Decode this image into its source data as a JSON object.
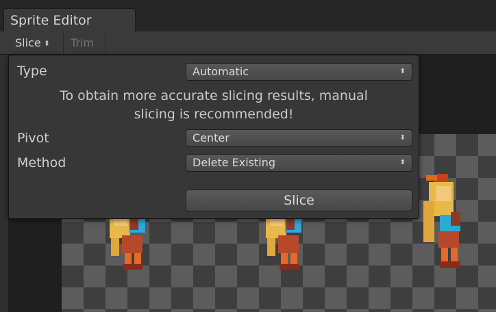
{
  "window": {
    "tab_title": "Sprite Editor"
  },
  "toolbar": {
    "slice_label": "Slice",
    "trim_label": "Trim",
    "stepper_glyph": "⬍"
  },
  "popup": {
    "type_label": "Type",
    "type_value": "Automatic",
    "warning_line1": "To obtain more accurate slicing results, manual",
    "warning_line2": "slicing is recommended!",
    "pivot_label": "Pivot",
    "pivot_value": "Center",
    "method_label": "Method",
    "method_value": "Delete Existing",
    "slice_button": "Slice",
    "dropdown_arrow_glyph": "⬍"
  },
  "icons": [
    "dropdown-stepper-icon"
  ],
  "colors": {
    "panel_bg": "#373737",
    "toolbar_bg": "#3a3a3a",
    "checker_dark": "#3e3e3e",
    "checker_light": "#5c5c5c"
  }
}
